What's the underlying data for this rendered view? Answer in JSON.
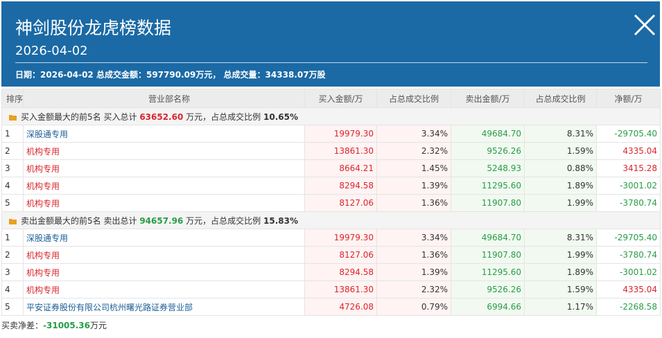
{
  "header": {
    "title": "神剑股份龙虎榜数据",
    "date": "2026-04-02",
    "summary_date_label": "日期：",
    "summary_date": "2026-04-02",
    "summary_amount_label": "总成交金额：",
    "summary_amount": "597790.09万元，",
    "summary_volume_label": "总成交量：",
    "summary_volume": "34338.07万股"
  },
  "columns": [
    "排序",
    "营业部名称",
    "买入金额/万",
    "占总成交比例",
    "卖出金额/万",
    "占总成交比例",
    "净额/万"
  ],
  "buy_group": {
    "label": "买入金额最大的前5名",
    "total_label": "买入总计",
    "total": "63652.60",
    "unit_text": "万元，占总成交比例",
    "ratio": "10.65%"
  },
  "buy_rows": [
    {
      "rank": "1",
      "dept": "深股通专用",
      "dept_color": "blue",
      "buy": "19979.30",
      "buy_pct": "3.34%",
      "sell": "49684.70",
      "sell_pct": "8.31%",
      "net": "-29705.40",
      "net_color": "green"
    },
    {
      "rank": "2",
      "dept": "机构专用",
      "dept_color": "red",
      "buy": "13861.30",
      "buy_pct": "2.32%",
      "sell": "9526.26",
      "sell_pct": "1.59%",
      "net": "4335.04",
      "net_color": "red"
    },
    {
      "rank": "3",
      "dept": "机构专用",
      "dept_color": "red",
      "buy": "8664.21",
      "buy_pct": "1.45%",
      "sell": "5248.93",
      "sell_pct": "0.88%",
      "net": "3415.28",
      "net_color": "red"
    },
    {
      "rank": "4",
      "dept": "机构专用",
      "dept_color": "red",
      "buy": "8294.58",
      "buy_pct": "1.39%",
      "sell": "11295.60",
      "sell_pct": "1.89%",
      "net": "-3001.02",
      "net_color": "green"
    },
    {
      "rank": "5",
      "dept": "机构专用",
      "dept_color": "red",
      "buy": "8127.06",
      "buy_pct": "1.36%",
      "sell": "11907.80",
      "sell_pct": "1.99%",
      "net": "-3780.74",
      "net_color": "green"
    }
  ],
  "sell_group": {
    "label": "卖出金额最大的前5名",
    "total_label": "卖出总计",
    "total": "94657.96",
    "unit_text": "万元，占总成交比例",
    "ratio": "15.83%"
  },
  "sell_rows": [
    {
      "rank": "1",
      "dept": "深股通专用",
      "dept_color": "blue",
      "buy": "19979.30",
      "buy_pct": "3.34%",
      "sell": "49684.70",
      "sell_pct": "8.31%",
      "net": "-29705.40",
      "net_color": "green"
    },
    {
      "rank": "2",
      "dept": "机构专用",
      "dept_color": "red",
      "buy": "8127.06",
      "buy_pct": "1.36%",
      "sell": "11907.80",
      "sell_pct": "1.99%",
      "net": "-3780.74",
      "net_color": "green"
    },
    {
      "rank": "3",
      "dept": "机构专用",
      "dept_color": "red",
      "buy": "8294.58",
      "buy_pct": "1.39%",
      "sell": "11295.60",
      "sell_pct": "1.89%",
      "net": "-3001.02",
      "net_color": "green"
    },
    {
      "rank": "4",
      "dept": "机构专用",
      "dept_color": "red",
      "buy": "13861.30",
      "buy_pct": "2.32%",
      "sell": "9526.26",
      "sell_pct": "1.59%",
      "net": "4335.04",
      "net_color": "red"
    },
    {
      "rank": "5",
      "dept": "平安证券股份有限公司杭州曙光路证券营业部",
      "dept_color": "blue",
      "buy": "4726.08",
      "buy_pct": "0.79%",
      "sell": "6994.66",
      "sell_pct": "1.17%",
      "net": "-2268.58",
      "net_color": "green"
    }
  ],
  "footer": {
    "label": "买卖净差：",
    "value": "-31005.36",
    "unit": "万元"
  },
  "icons": {
    "close": "close-icon",
    "group": "folder-icon"
  },
  "colors": {
    "header_bg": "#1b6aa5",
    "buy": "#d9262c",
    "sell": "#299c46",
    "link": "#1a5e95"
  }
}
